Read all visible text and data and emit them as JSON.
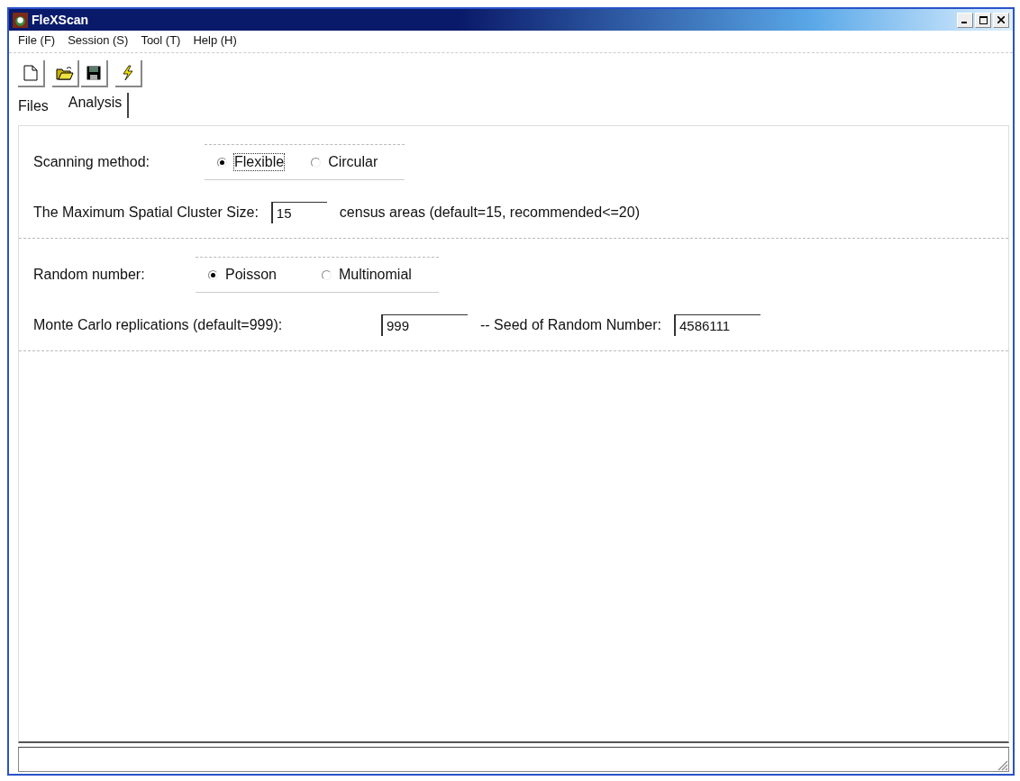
{
  "window": {
    "title": "FleXScan"
  },
  "menu": [
    "File (F)",
    "Session (S)",
    "Tool (T)",
    "Help (H)"
  ],
  "toolbar": [
    {
      "kind": "new"
    },
    {
      "kind": "open"
    },
    {
      "kind": "save"
    },
    {
      "kind": "run"
    }
  ],
  "tabs": [
    {
      "label": "Files",
      "selected": false
    },
    {
      "label": "Analysis",
      "selected": true
    }
  ],
  "scanning": {
    "label": "Scanning method:",
    "options": [
      {
        "label": "Flexible",
        "selected": true
      },
      {
        "label": "Circular",
        "selected": false
      }
    ]
  },
  "cluster": {
    "label": "The Maximum Spatial Cluster Size:",
    "value": "15",
    "note": "census areas (default=15, recommended<=20)"
  },
  "random": {
    "label": "Random number:",
    "options": [
      {
        "label": "Poisson",
        "selected": true
      },
      {
        "label": "Multinomial",
        "selected": false
      }
    ]
  },
  "replications": {
    "label": "Monte Carlo replications (default=999):",
    "value": "999"
  },
  "seed": {
    "label": "-- Seed of Random Number:",
    "value": "4586111"
  }
}
